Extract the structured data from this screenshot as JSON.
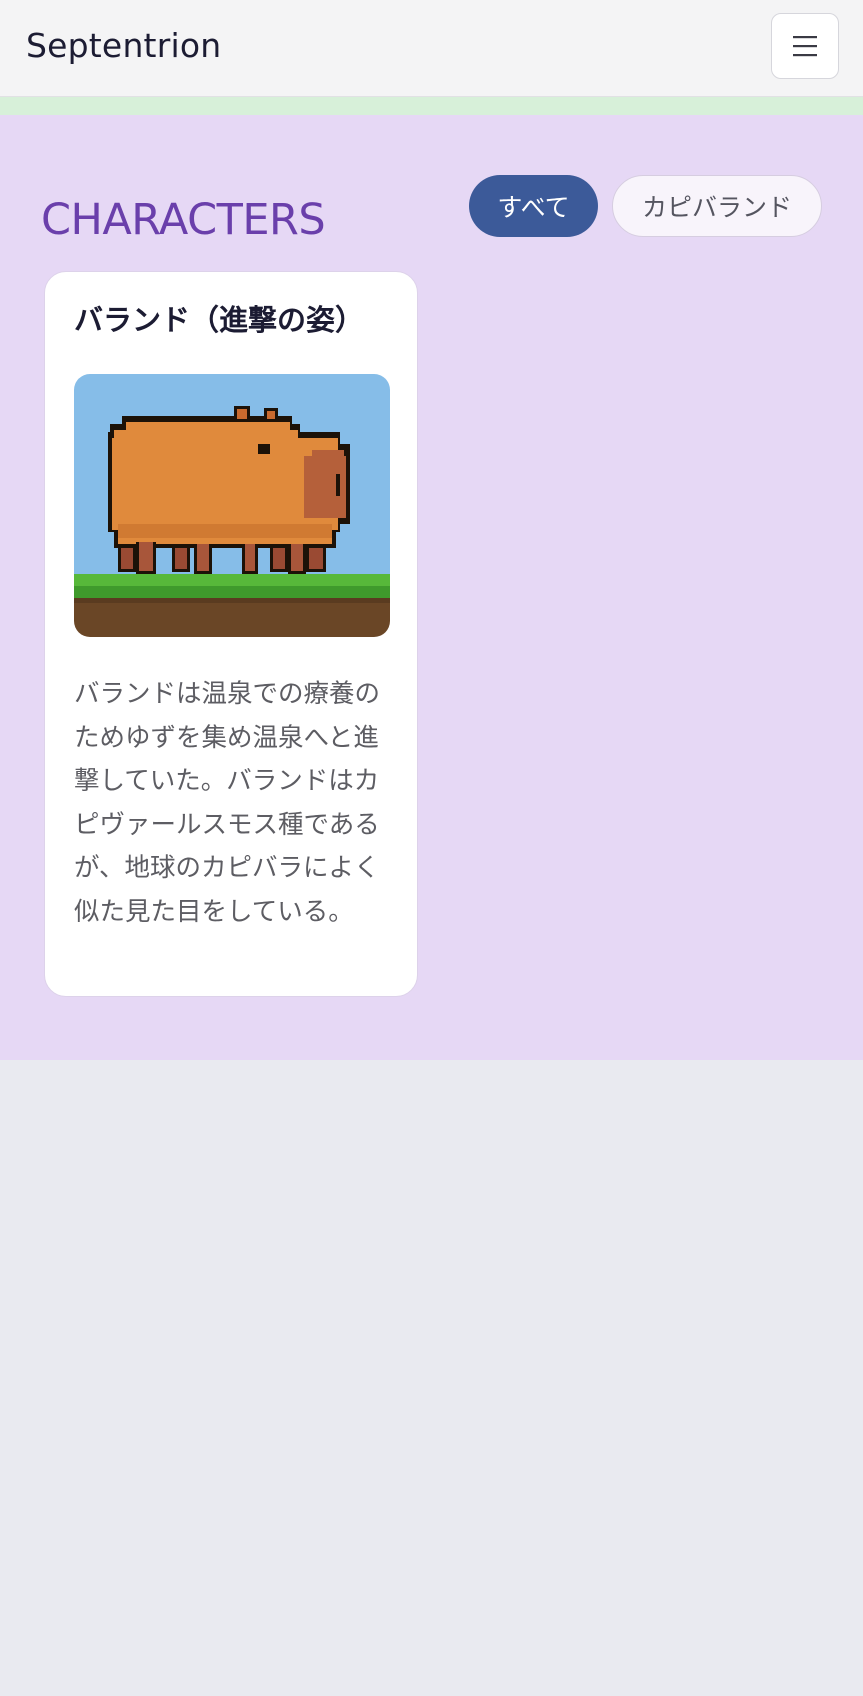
{
  "header": {
    "brand": "Septentrion",
    "menu_icon": "hamburger-icon",
    "menu_glyph": "☰"
  },
  "section": {
    "title": "CHARACTERS",
    "filters": [
      {
        "label": "すべて",
        "active": true
      },
      {
        "label": "カピバランド",
        "active": false
      }
    ]
  },
  "cards": [
    {
      "title": "バランド（進撃の姿）",
      "image_icon": "capybara-pixel-art-image",
      "description": "バランドは温泉での療養のためゆずを集め温泉へと進撃していた。バランドはカピヴァールスモス種であるが、地球のカピバラによく似た見た目をしている。"
    }
  ],
  "colors": {
    "header_bg": "#f4f4f5",
    "strip": "#d7f0d9",
    "section_bg": "#e6d8f5",
    "page_bg": "#e9eaf0",
    "title_purple": "#6a3fab",
    "active_filter": "#3c5a99",
    "sky": "#86bde8",
    "capybara": "#e08a3c",
    "grass": "#4aa833",
    "soil": "#6a4626"
  }
}
